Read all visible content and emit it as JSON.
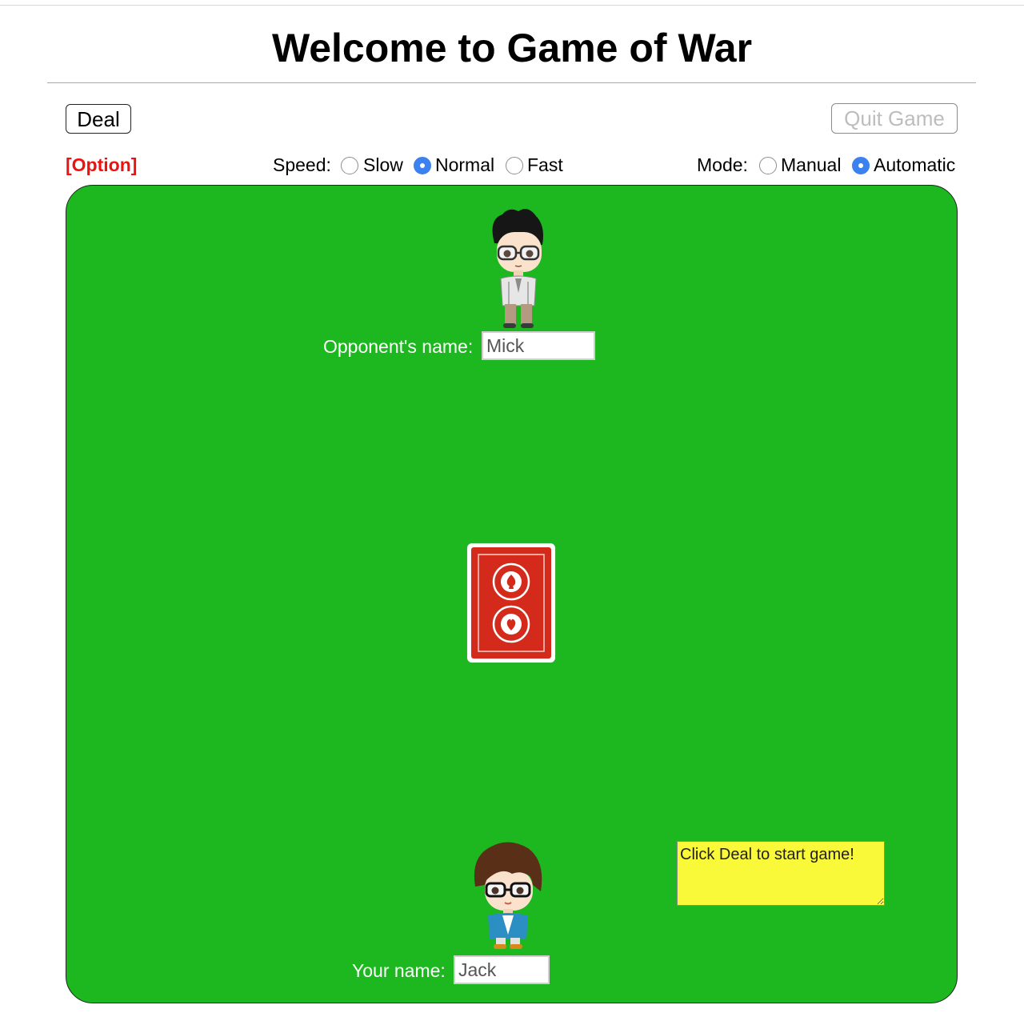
{
  "page_title": "Welcome to Game of War",
  "toolbar": {
    "deal_label": "Deal",
    "quit_label": "Quit Game"
  },
  "options": {
    "option_link": "[Option]",
    "speed_label": "Speed:",
    "speed_options": [
      {
        "label": "Slow",
        "checked": false
      },
      {
        "label": "Normal",
        "checked": true
      },
      {
        "label": "Fast",
        "checked": false
      }
    ],
    "mode_label": "Mode:",
    "mode_options": [
      {
        "label": "Manual",
        "checked": false
      },
      {
        "label": "Automatic",
        "checked": true
      }
    ]
  },
  "board": {
    "opponent_label": "Opponent's name:",
    "opponent_name": "Mick",
    "player_label": "Your name:",
    "player_name": "Jack",
    "status_message": "Click Deal to start game!",
    "table_color": "#1db820",
    "card_back_color": "#d42a1c",
    "status_color": "#f9f93a",
    "opponent_avatar": "boy-glasses-avatar",
    "player_avatar": "brown-hair-glasses-avatar",
    "deck": "card-back"
  },
  "colors": {
    "option_red": "#ee1111",
    "radio_blue": "#3b82f0"
  }
}
